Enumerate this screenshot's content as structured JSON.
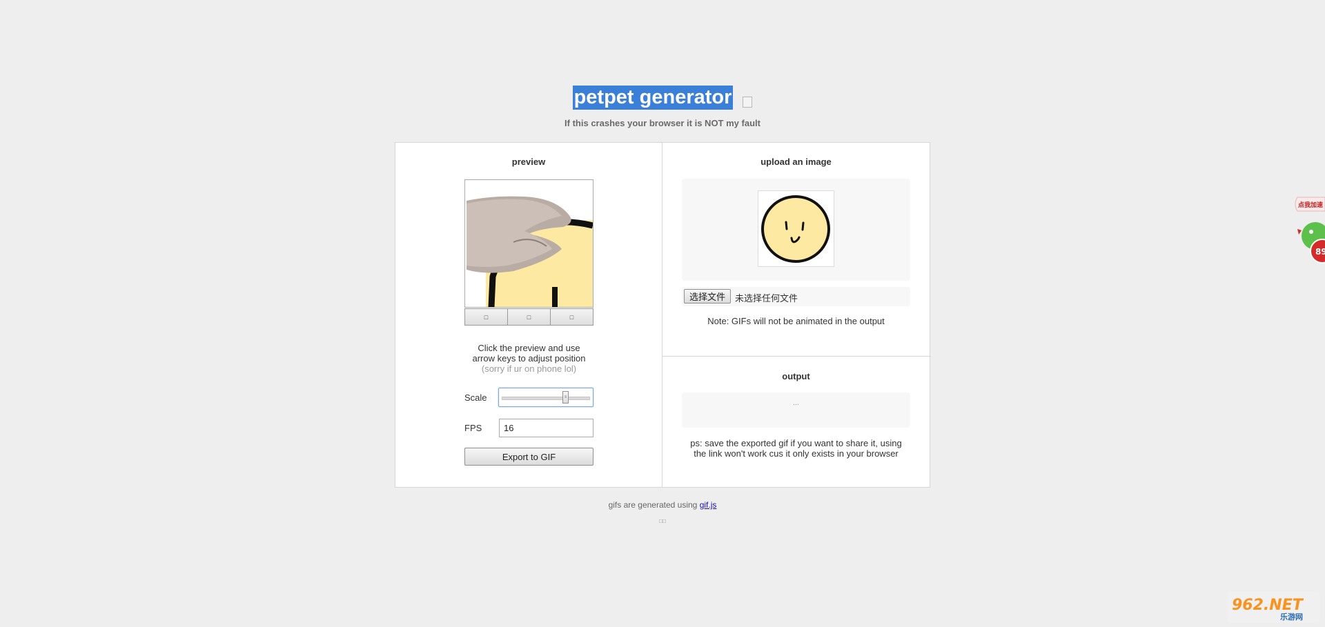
{
  "header": {
    "title": "petpet generator",
    "subtitle": "If this crashes your browser it is NOT my fault"
  },
  "preview": {
    "section_title": "preview",
    "buttons": [
      "□",
      "□",
      "□"
    ],
    "hint_line1": "Click the preview and use",
    "hint_line2": "arrow keys to adjust position",
    "hint_muted": "(sorry if ur on phone lol)",
    "scale_label": "Scale",
    "scale_value": 0.74,
    "fps_label": "FPS",
    "fps_value": "16",
    "export_label": "Export to GIF"
  },
  "upload": {
    "section_title": "upload an image",
    "file_button": "选择文件",
    "file_status": "未选择任何文件",
    "note": "Note: GIFs will not be animated in the output"
  },
  "output": {
    "section_title": "output",
    "placeholder": "...",
    "ps_line1": "ps: save the exported gif if you want to share it, using",
    "ps_line2": "the link won't work cus it only exists in your browser"
  },
  "footer": {
    "text": "gifs are generated using",
    "link": "gif.js",
    "small": "□□"
  },
  "side_widget": {
    "tag": "点我加速",
    "badge": "89"
  },
  "site_logo": {
    "text": "962.NET",
    "sub": "乐游网"
  },
  "colors": {
    "background": "#eeeeee",
    "title_highlight": "#3a7fd8",
    "face_fill": "#fde9a2",
    "link": "#1a0dab"
  }
}
